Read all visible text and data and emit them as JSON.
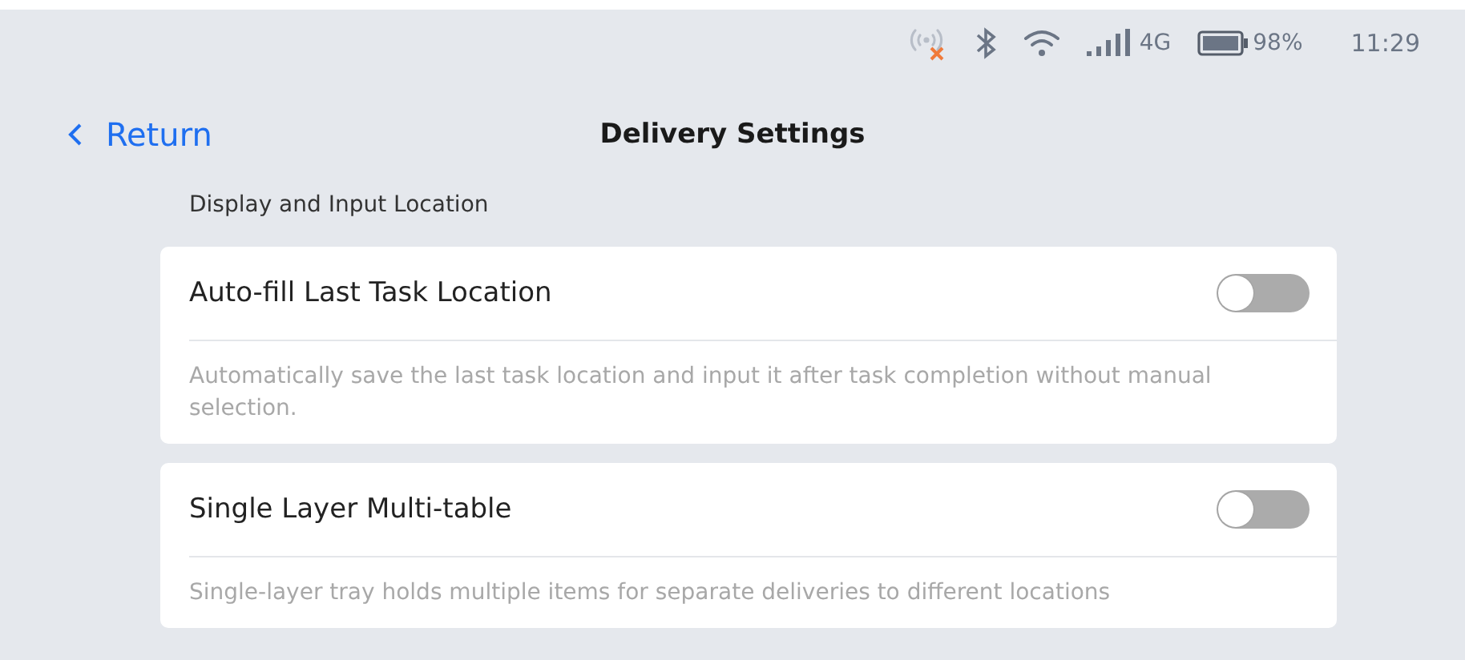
{
  "status_bar": {
    "network": "4G",
    "battery": "98%",
    "time": "11:29"
  },
  "header": {
    "back": "Return",
    "title": "Delivery Settings"
  },
  "section": {
    "title": "Display and Input Location",
    "settings": [
      {
        "label": "Auto-fill Last Task Location",
        "on": false,
        "description": "Automatically save the last task location and input it after task completion without manual selection."
      },
      {
        "label": "Single Layer Multi-table",
        "on": false,
        "description": "Single-layer tray holds multiple items for separate deliveries to different locations"
      }
    ]
  }
}
